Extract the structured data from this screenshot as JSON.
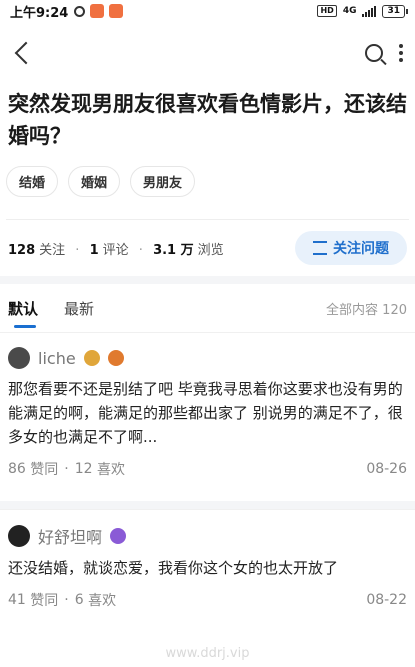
{
  "status_bar": {
    "time": "上午9:24",
    "network_type": "4G",
    "hd_label": "HD",
    "battery": "31"
  },
  "question": {
    "title": "突然发现男朋友很喜欢看色情影片，还该结婚吗？",
    "tags": [
      "结婚",
      "婚姻",
      "男朋友"
    ],
    "stats": {
      "follow_count": "128",
      "follow_label": "关注",
      "comment_count": "1",
      "comment_label": "评论",
      "view_count": "3.1 万",
      "view_label": "浏览"
    },
    "follow_button": "关注问题"
  },
  "tabs": {
    "default": "默认",
    "latest": "最新",
    "total_label": "全部内容 120"
  },
  "answers": [
    {
      "username": "liche",
      "text": "那您看要不还是别结了吧 毕竟我寻思着你这要求也没有男的能满足的啊，能满足的那些都出家了 别说男的满足不了，很多女的也满足不了啊...",
      "likes": "86",
      "likes_label": "赞同",
      "replies": "12",
      "replies_label": "喜欢",
      "date": "08-26"
    },
    {
      "username": "好舒坦啊",
      "text": "还没结婚，就谈恋爱，我看你这个女的也太开放了",
      "likes": "41",
      "likes_label": "赞同",
      "replies": "6",
      "replies_label": "喜欢",
      "date": "08-22"
    }
  ],
  "watermark": "www.ddrj.vip",
  "colors": {
    "accent": "#1f6fcc",
    "follow_bg": "#e8f1fb",
    "badge_gold": "#e0a63a",
    "badge_orange": "#e07a2e",
    "badge_purple": "#8a5bd6"
  }
}
